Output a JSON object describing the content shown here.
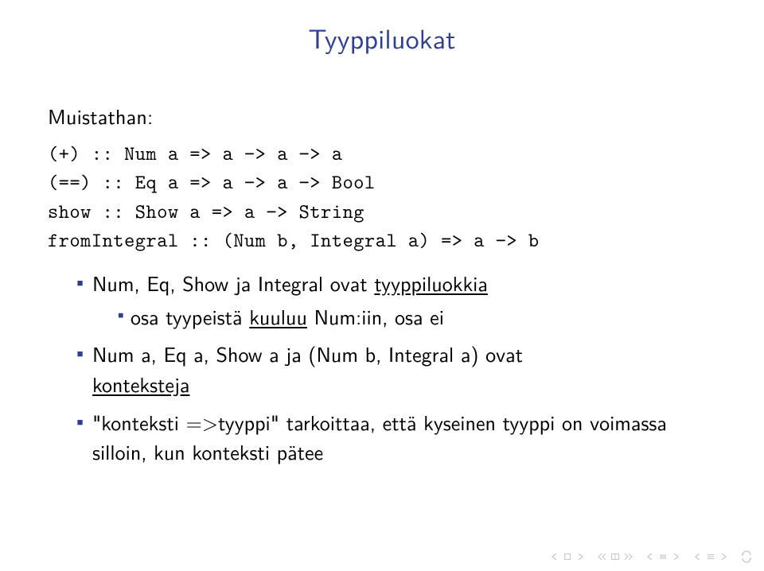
{
  "title": "Tyyppiluokat",
  "intro": "Muistathan:",
  "code_lines": {
    "l1": "(+) :: Num a => a −> a −> a",
    "l2": "(==) :: Eq a => a −> a −> Bool",
    "l3": "show :: Show a => a −> String",
    "l4": "fromIntegral :: (Num b, Integral a) => a −> b"
  },
  "bullets": {
    "b1_pre": "Num, Eq, Show ja Integral ovat ",
    "b1_u": "tyyppiluokkia",
    "b1_sub_pre": "osa tyypeistä ",
    "b1_sub_u": "kuuluu",
    "b1_sub_post": " Num:iin, osa ei",
    "b2_pre": "Num a, Eq a, Show a ja (Num b, Integral a) ovat ",
    "b2_u": "konteksteja",
    "b3": "\"konteksti =>tyyppi\" tarkoittaa, että kyseinen tyyppi on voimassa silloin, kun konteksti pätee"
  }
}
